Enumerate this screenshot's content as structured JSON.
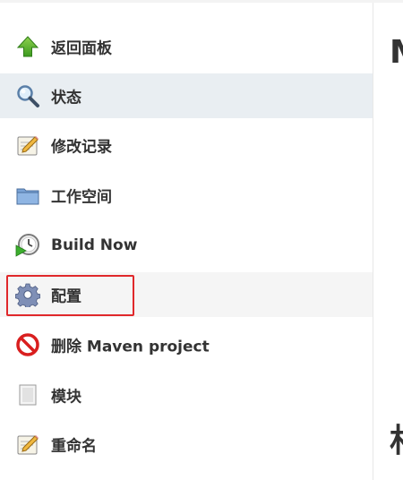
{
  "sidebar": {
    "items": [
      {
        "label": "返回面板",
        "icon": "up-arrow-icon"
      },
      {
        "label": "状态",
        "icon": "search-icon"
      },
      {
        "label": "修改记录",
        "icon": "notepad-icon"
      },
      {
        "label": "工作空间",
        "icon": "folder-icon"
      },
      {
        "label": "Build Now",
        "icon": "clock-play-icon"
      },
      {
        "label": "配置",
        "icon": "gear-icon"
      },
      {
        "label": "删除 Maven project",
        "icon": "no-entry-icon"
      },
      {
        "label": "模块",
        "icon": "document-icon"
      },
      {
        "label": "重命名",
        "icon": "notepad-icon"
      }
    ],
    "active_index": 1,
    "highlighted_index": 5
  },
  "main": {
    "heading_fragment": "M",
    "heading2_fragment": "村"
  },
  "colors": {
    "active_bg": "#e9eef2",
    "highlight_border": "#e0282b"
  }
}
